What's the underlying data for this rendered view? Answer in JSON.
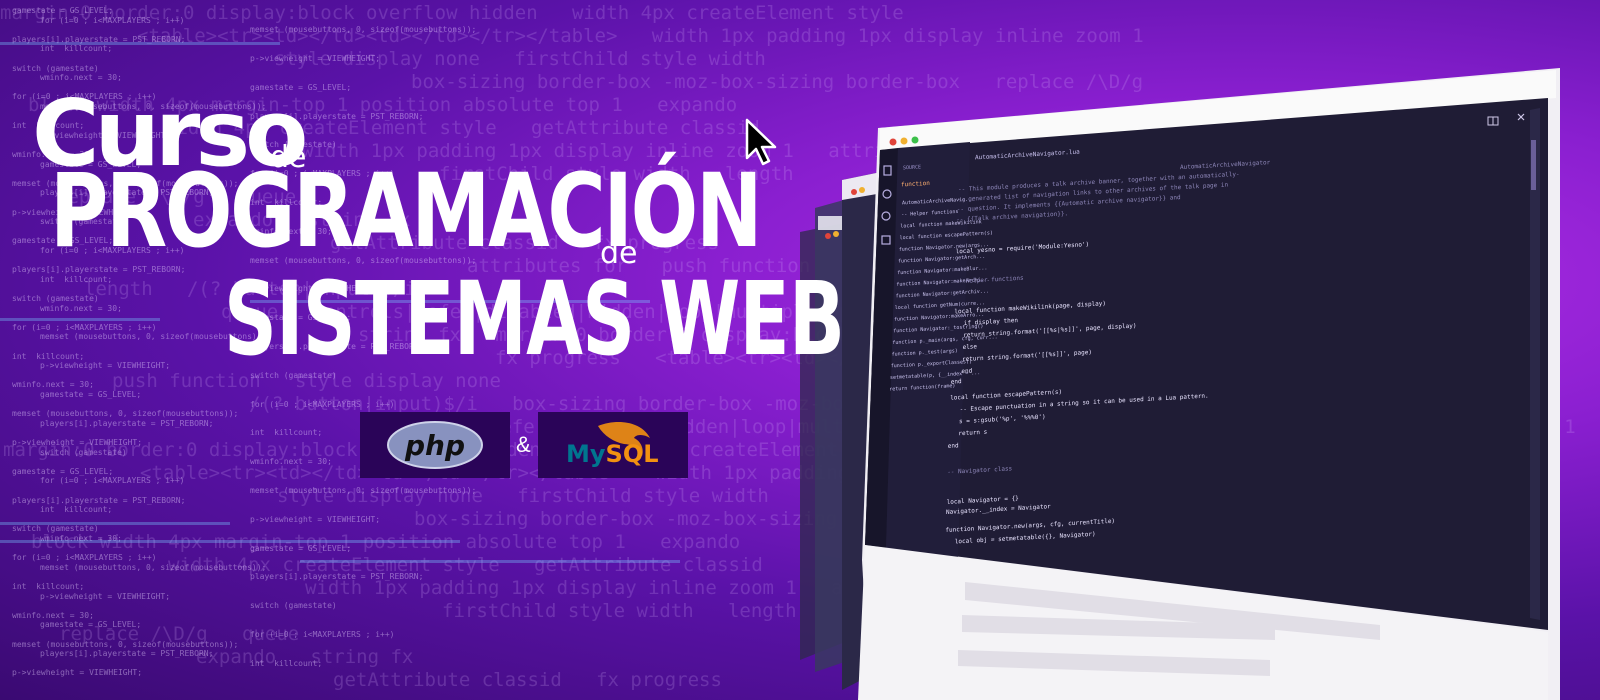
{
  "title": {
    "curso": "Curso",
    "de_1": "de",
    "programacion": "PROGRAMACIÓN",
    "de_2": "de",
    "sistemas_web": "SISTEMAS WEB"
  },
  "logos": {
    "php": "php",
    "ampersand": "&",
    "mysql_my": "My",
    "mysql_sql": "SQL"
  },
  "editor": {
    "sidebar_title": "SOURCE",
    "sidebar_filter": "function",
    "tab_label": "AutomaticArchiveNavigator.lua",
    "header_comment": "AutomaticArchiveNavigator",
    "lines": [
      "-- This module produces a talk archive banner, together with an automatically-",
      "-- generated list of navigation links to other archives of the talk page in",
      "-- question. It implements {{Automatic archive navigator}} and",
      "-- {{Talk archive navigation}}.",
      "local yesno = require('Module:Yesno')",
      "-- Helper functions",
      "local function makeWikilink(page, display)",
      "  if display then",
      "    return string.format('[[%s|%s]]', page, display)",
      "  else",
      "    return string.format('[[%s]]', page)",
      "  end",
      "end",
      "local function escapePattern(s)",
      "  -- Escape punctuation in a string so it can be used in a Lua pattern.",
      "  s = s:gsub('%p', '%%%0')",
      "  return s",
      "end",
      "-- Navigator class",
      "local Navigator = {}",
      "Navigator.__index = Navigator",
      "function Navigator.new(args, cfg, currentTitle)",
      "  local obj = setmetatable({}, Navigator)"
    ],
    "outline": [
      "AutomaticArchiveNavig...",
      "-- Helper functions",
      "local function makeWikilink",
      "local function escapePattern(s)",
      "function Navigator.new(args...",
      "function Navigator:getArch...",
      "function Navigator:makeBlur...",
      "function Navigator:makeArchi...",
      "function Navigator:getArchiv...",
      "local function getNum(curre...",
      "function Navigator:makeArro...",
      "function Navigator:_tostring()",
      "function p._main(args, cfg, curr...",
      "function p._test(args)",
      "function p._exportClasses()",
      "setmetatable(p, {__index = ...",
      "return function(frame)"
    ]
  },
  "colors": {
    "background": "#8a1fd0",
    "editor_bg": "#1e1c33",
    "logo_box": "#2a0458",
    "php_oval": "#8892bf",
    "mysql_blue": "#00758f",
    "mysql_orange": "#f29111"
  },
  "icons": [
    "mouse-cursor-icon",
    "php-logo",
    "mysql-dolphin-logo",
    "window-close-icon",
    "split-editor-icon"
  ]
}
